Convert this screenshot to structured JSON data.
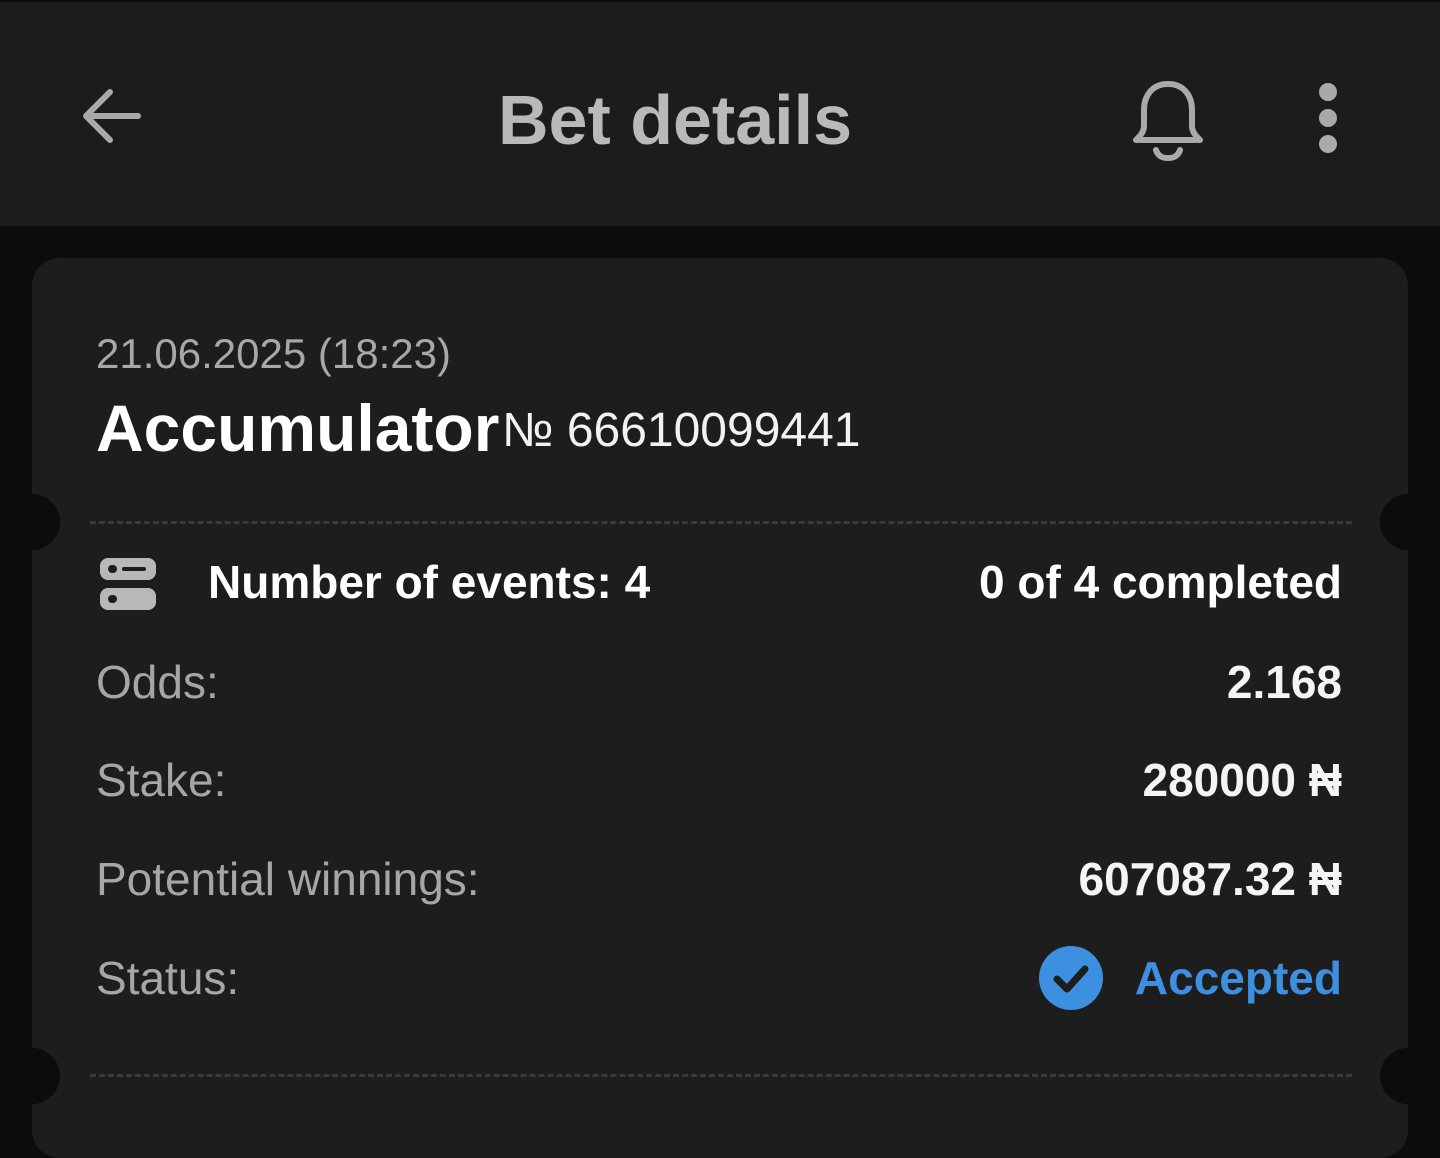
{
  "header": {
    "title": "Bet details",
    "back_icon": "arrow-left-icon",
    "notification_icon": "bell-icon",
    "menu_icon": "more-vertical-icon"
  },
  "bet": {
    "date": "21.06.2025 (18:23)",
    "type": "Accumulator",
    "number": "№ 66610099441",
    "events_icon": "list-toggle-icon",
    "events_label": "Number of events: 4",
    "events_progress": "0 of 4 completed",
    "odds_label": "Odds:",
    "odds_value": "2.168",
    "stake_label": "Stake:",
    "stake_value": "280000 ₦",
    "winnings_label": "Potential winnings:",
    "winnings_value": "607087.32 ₦",
    "status_label": "Status:",
    "status_value": "Accepted",
    "status_icon": "check-circle-icon",
    "status_color": "#3d8fe0"
  },
  "colors": {
    "background": "#0c0c0c",
    "topbar": "#1c1c1c",
    "card": "#1d1d1d",
    "accent": "#3d8fe0"
  }
}
